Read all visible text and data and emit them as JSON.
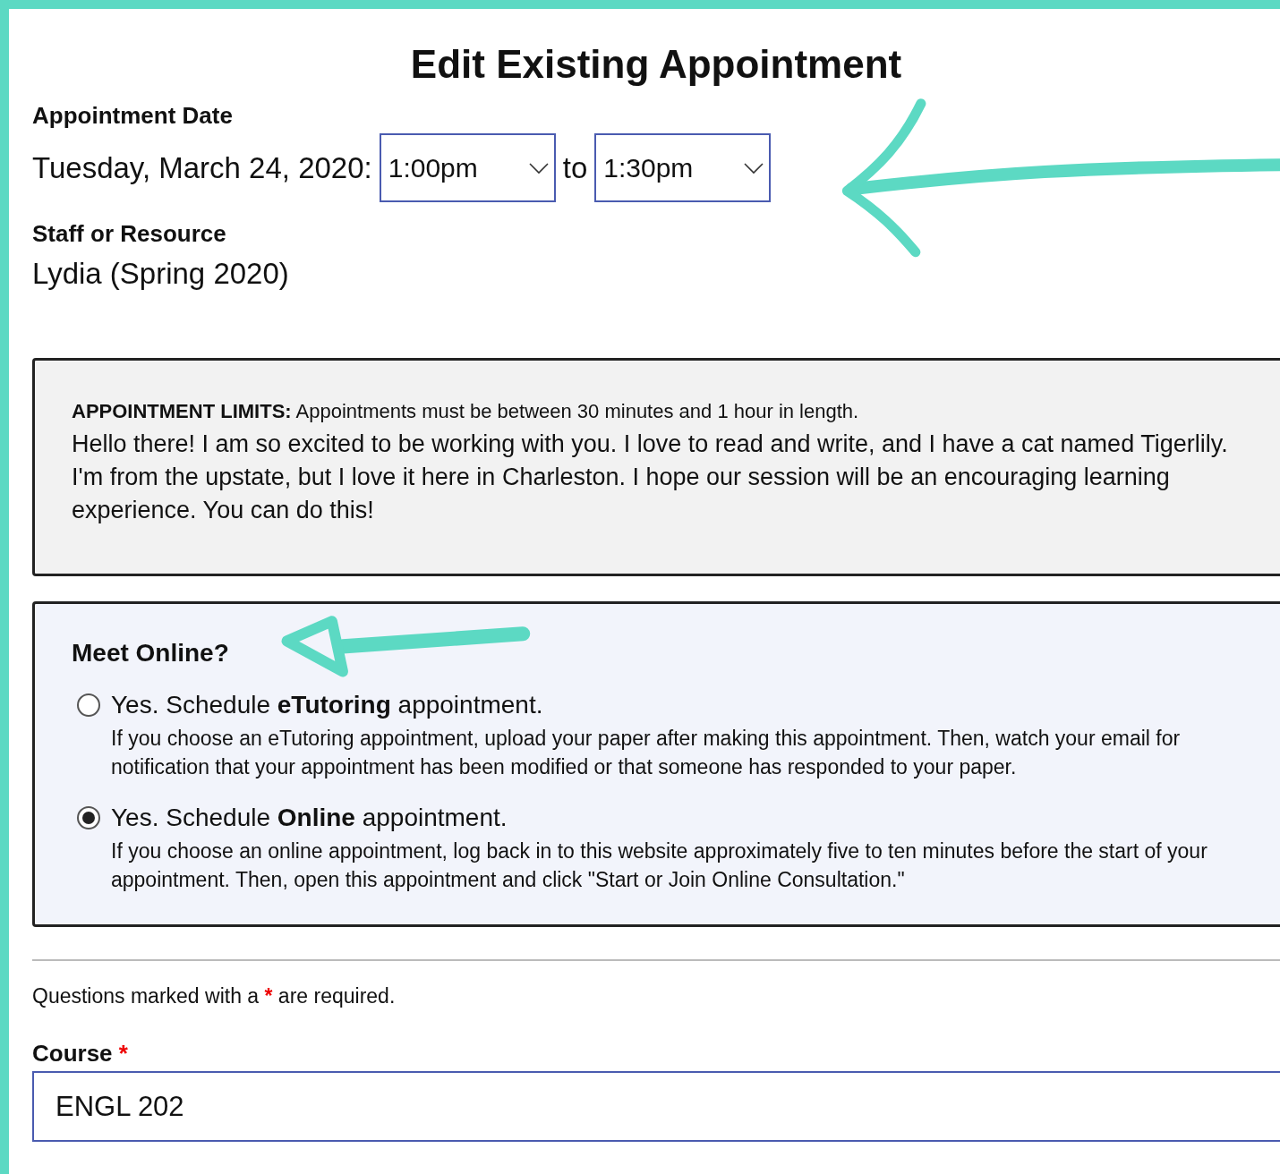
{
  "title": "Edit Existing Appointment",
  "date": {
    "label": "Appointment Date",
    "value": "Tuesday, March 24, 2020:",
    "start": "1:00pm",
    "separator": "to",
    "end": "1:30pm"
  },
  "staff": {
    "label": "Staff or Resource",
    "value": "Lydia (Spring 2020)"
  },
  "limits": {
    "text": "**APPOINTMENT LIMITS:** Appointments must be between 30 minutes and 1 hour in length.",
    "bio": "Hello there! I am so excited to be working with you. I love to read and write, and I have a cat named Tigerlily. I'm from the upstate, but I love it here in Charleston. I hope our session will be an encouraging learning experience. You can do this!"
  },
  "meet_online": {
    "heading": "Meet Online?",
    "options": [
      {
        "label": "Yes. Schedule **eTutoring** appointment.",
        "description": "If you choose an eTutoring appointment, upload your paper after making this appointment. Then, watch your email for notification that your appointment has been modified or that someone has responded to your paper.",
        "selected": false
      },
      {
        "label": "Yes. Schedule **Online** appointment.",
        "description": "If you choose an online appointment, log back in to this website approximately five to ten minutes before the start of your appointment. Then, open this appointment and click \"Start or Join Online Consultation.\"",
        "selected": true
      }
    ]
  },
  "required_note": {
    "text": "Questions marked with a",
    "mark": "*",
    "rest": "are required."
  },
  "course": {
    "label": "Course",
    "required_mark": "*",
    "value": "ENGL 202"
  }
}
